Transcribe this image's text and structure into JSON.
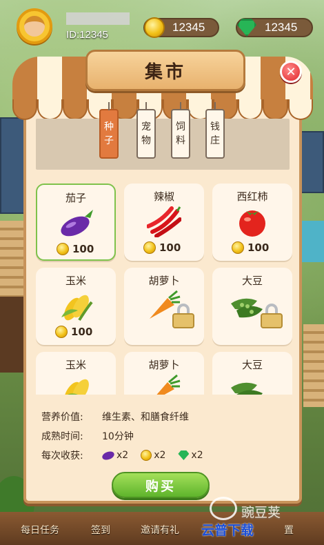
{
  "hud": {
    "player_id": "ID:12345",
    "gold": "12345",
    "gems": "12345"
  },
  "panel": {
    "title": "集市",
    "tabs": [
      {
        "line1": "种",
        "line2": "子"
      },
      {
        "line1": "宠",
        "line2": "物"
      },
      {
        "line1": "饲",
        "line2": "料"
      },
      {
        "line1": "钱",
        "line2": "庄"
      }
    ],
    "items": [
      {
        "name": "茄子",
        "price": "100",
        "icon": "eggplant-icon"
      },
      {
        "name": "辣椒",
        "price": "100",
        "icon": "chili-icon"
      },
      {
        "name": "西红柿",
        "price": "100",
        "icon": "tomato-icon"
      },
      {
        "name": "玉米",
        "price": "100",
        "icon": "corn-icon"
      },
      {
        "name": "胡萝卜",
        "icon": "carrot-icon"
      },
      {
        "name": "大豆",
        "icon": "soybean-icon"
      },
      {
        "name": "玉米",
        "icon": "corn-icon"
      },
      {
        "name": "胡萝卜",
        "icon": "carrot-icon"
      },
      {
        "name": "大豆",
        "icon": "soybean-icon"
      }
    ]
  },
  "info": {
    "nutrition_label": "营养价值:",
    "nutrition_value": "维生素、和膳食纤维",
    "mature_label": "成熟时间:",
    "mature_value": "10分钟",
    "yield_label": "每次收获:",
    "yield_eggplant": "x2",
    "yield_coin": "x2",
    "yield_gem": "x2"
  },
  "buy_label": "购买",
  "bottom_nav": {
    "daily_tasks": "每日任务",
    "signin": "签到",
    "invite": "邀请有礼",
    "settings": "置"
  },
  "watermark": {
    "line1": "豌豆荚",
    "line2": "云普下载"
  },
  "colors": {
    "accent_green": "#7ec24b",
    "tab_active": "#e27a3f",
    "panel_bg": "#fbe9cf"
  }
}
